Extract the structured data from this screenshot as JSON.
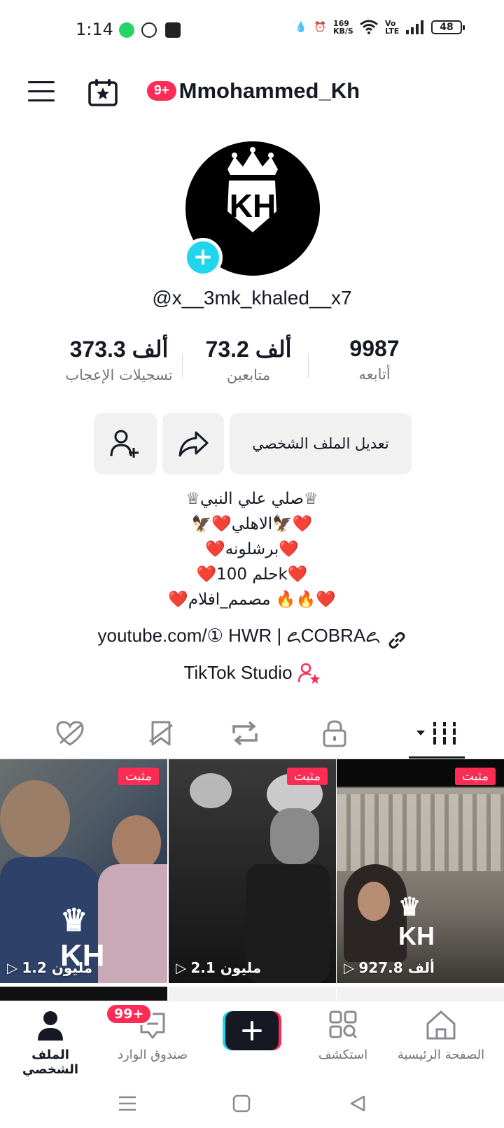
{
  "status_bar": {
    "time": "1:14",
    "network_speed": "169 KB/S",
    "network_type": "Vo LTE",
    "battery": "48",
    "icons": [
      "whatsapp-business-icon",
      "whatsapp-icon",
      "mail-icon",
      "drop-icon",
      "alarm-icon",
      "wifi-icon",
      "signal-icon",
      "battery-icon"
    ]
  },
  "header": {
    "notification_badge": "9+",
    "title": "Mmohammed_Kh"
  },
  "profile": {
    "username": "@x__3mk_khaled__x7",
    "avatar_text": "KH"
  },
  "stats": [
    {
      "value": "373.3 ألف",
      "label": "تسجيلات الإعجاب"
    },
    {
      "value": "73.2 ألف",
      "label": "متابعين"
    },
    {
      "value": "9987",
      "label": "أتابعه"
    }
  ],
  "actions": {
    "edit_profile": "تعديل الملف الشخصي"
  },
  "bio": [
    "♕صلي علي النبي♕",
    "🦅❤️الاهلي🦅❤️",
    "❤️برشلونه❤️",
    "❤️حلم 100k❤️",
    "❤️مصمم_افلام 🔥🔥❤️"
  ],
  "link": "youtube.com/① HWR | ꧖COBRA꧖",
  "studio": "TikTok Studio",
  "videos": [
    {
      "pinned": "مثبت",
      "views": "927.8 ألف"
    },
    {
      "pinned": "مثبت",
      "views": "2.1 مليون"
    },
    {
      "pinned": "مثبت",
      "views": "1.2 مليون"
    }
  ],
  "bottom_nav": {
    "home": "الصفحة الرئيسية",
    "discover": "استكشف",
    "inbox": "صندوق الوارد",
    "inbox_badge": "99+",
    "profile": "الملف الشخصي"
  },
  "colors": {
    "accent": "#fe2c55",
    "cyan": "#20d5ec",
    "text": "#161823",
    "muted": "#757575"
  }
}
